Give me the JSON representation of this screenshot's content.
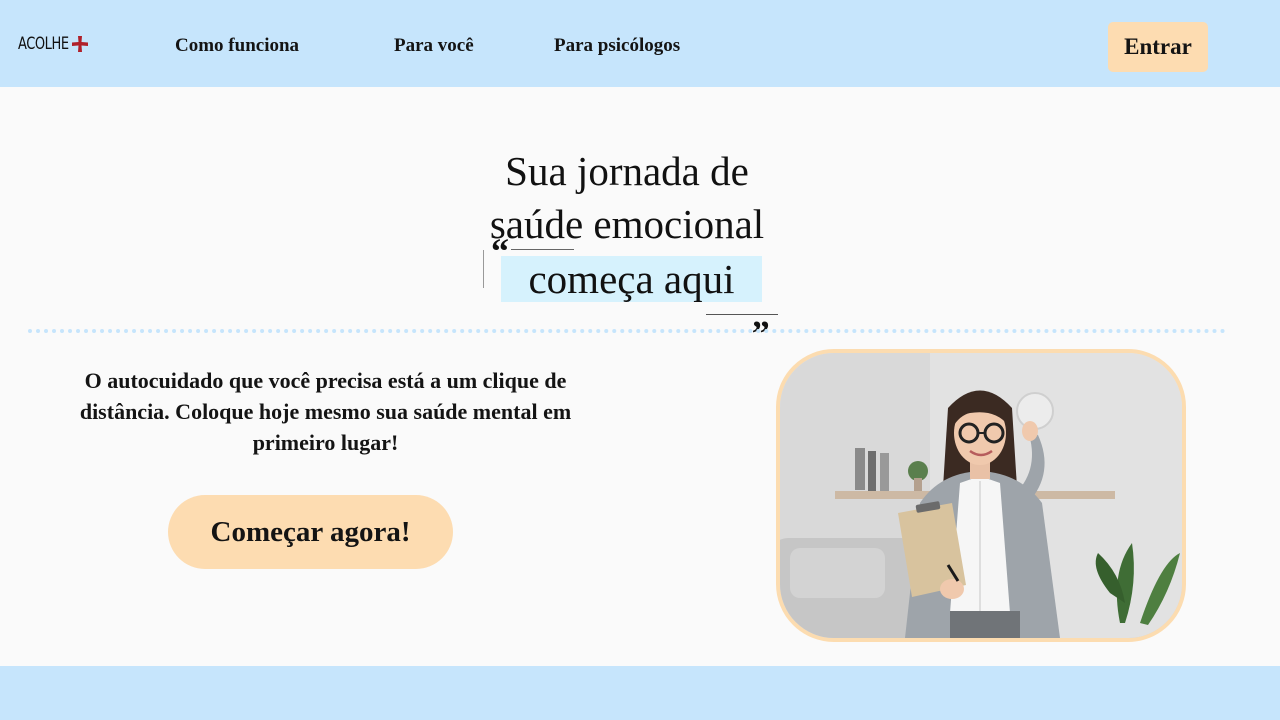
{
  "header": {
    "logo_text": "ACOLHE",
    "logo_icon": "plus-icon",
    "nav": [
      "Como funciona",
      "Para você",
      "Para psicólogos"
    ],
    "login_label": "Entrar"
  },
  "hero": {
    "title_line1": "Sua jornada de",
    "title_line2": "saúde emocional",
    "title_highlight": "começa aqui",
    "quote_open": "“",
    "quote_close": "„"
  },
  "main": {
    "tagline": "O autocuidado que você precisa está a um clique de distância. Coloque hoje mesmo sua saúde mental em primeiro lugar!",
    "cta_label": "Começar agora!",
    "photo_icon": "psychologist-photo"
  },
  "colors": {
    "header_bg": "#c6e5fc",
    "button_bg": "#fddcb1",
    "highlight_bg": "#d6f2fd",
    "logo_plus": "#b0202a"
  }
}
